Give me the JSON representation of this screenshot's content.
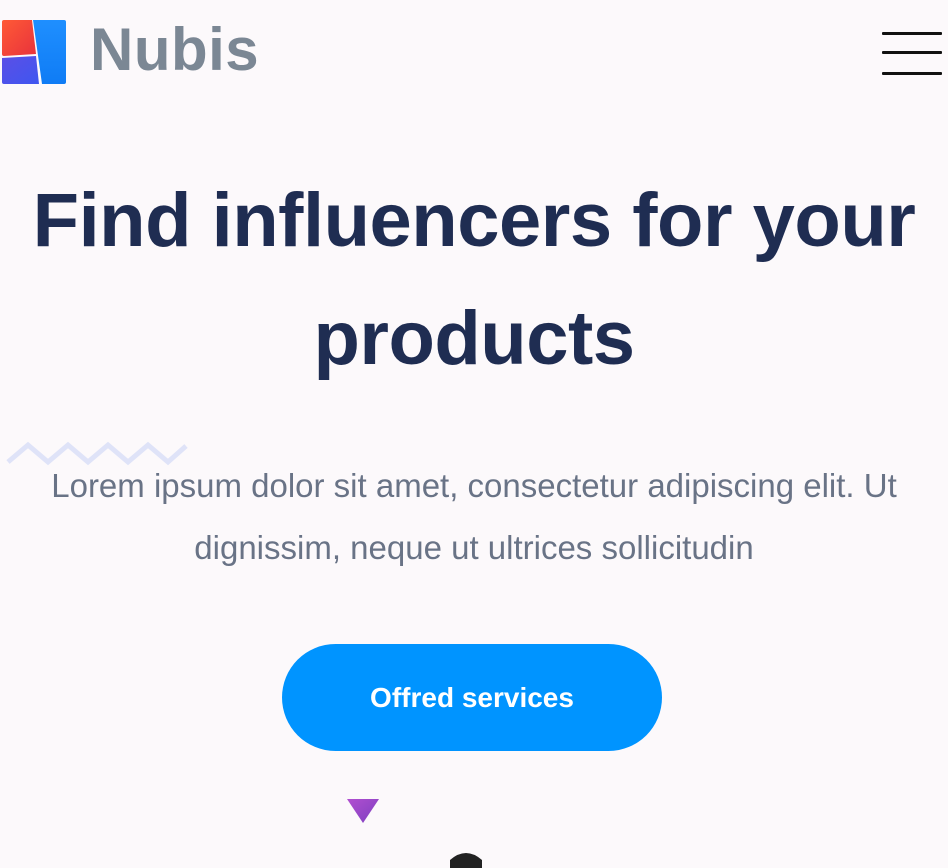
{
  "header": {
    "brand_name": "Nubis",
    "logo_icon": "nubis-logo-icon",
    "menu_icon": "hamburger-menu-icon"
  },
  "hero": {
    "title": "Find influencers for your products",
    "description": "Lorem ipsum dolor sit amet, consectetur adipiscing elit. Ut dignissim, neque ut ultrices sollicitudin",
    "cta_label": "Offred services"
  },
  "decorations": {
    "zigzag": "zigzag-icon",
    "triangle": "triangle-down-icon"
  },
  "colors": {
    "background": "#fcf9fb",
    "title": "#1f2d52",
    "text": "#697386",
    "brand_text": "#7b8794",
    "accent": "#0094ff",
    "zigzag": "#dfe3f8",
    "triangle": "#9b46c7",
    "logo_red": "#f2453b",
    "logo_blue": "#1a8cff",
    "logo_indigo": "#4f4fe0"
  }
}
